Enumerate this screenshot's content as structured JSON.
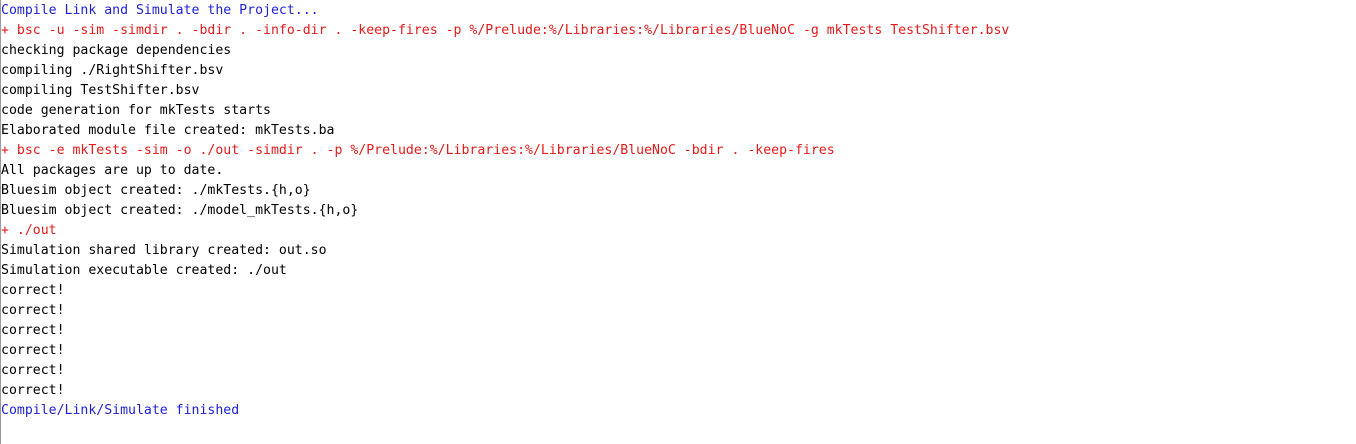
{
  "console": {
    "lines": [
      {
        "type": "info",
        "text": "Compile Link and Simulate the Project..."
      },
      {
        "type": "cmd",
        "text": "+ bsc -u -sim -simdir . -bdir . -info-dir . -keep-fires -p %/Prelude:%/Libraries:%/Libraries/BlueNoC -g mkTests TestShifter.bsv"
      },
      {
        "type": "out",
        "text": "checking package dependencies"
      },
      {
        "type": "out",
        "text": "compiling ./RightShifter.bsv"
      },
      {
        "type": "out",
        "text": "compiling TestShifter.bsv"
      },
      {
        "type": "out",
        "text": "code generation for mkTests starts"
      },
      {
        "type": "out",
        "text": "Elaborated module file created: mkTests.ba"
      },
      {
        "type": "cmd",
        "text": "+ bsc -e mkTests -sim -o ./out -simdir . -p %/Prelude:%/Libraries:%/Libraries/BlueNoC -bdir . -keep-fires"
      },
      {
        "type": "out",
        "text": "All packages are up to date."
      },
      {
        "type": "out",
        "text": "Bluesim object created: ./mkTests.{h,o}"
      },
      {
        "type": "out",
        "text": "Bluesim object created: ./model_mkTests.{h,o}"
      },
      {
        "type": "cmd",
        "text": "+ ./out"
      },
      {
        "type": "out",
        "text": "Simulation shared library created: out.so"
      },
      {
        "type": "out",
        "text": "Simulation executable created: ./out"
      },
      {
        "type": "out",
        "text": "correct!"
      },
      {
        "type": "out",
        "text": "correct!"
      },
      {
        "type": "out",
        "text": "correct!"
      },
      {
        "type": "out",
        "text": "correct!"
      },
      {
        "type": "out",
        "text": "correct!"
      },
      {
        "type": "out",
        "text": "correct!"
      },
      {
        "type": "info",
        "text": "Compile/Link/Simulate finished"
      }
    ]
  },
  "colors": {
    "info": "#1f1fd6",
    "command": "#e31b1b",
    "output": "#000000",
    "background": "#ffffff"
  }
}
